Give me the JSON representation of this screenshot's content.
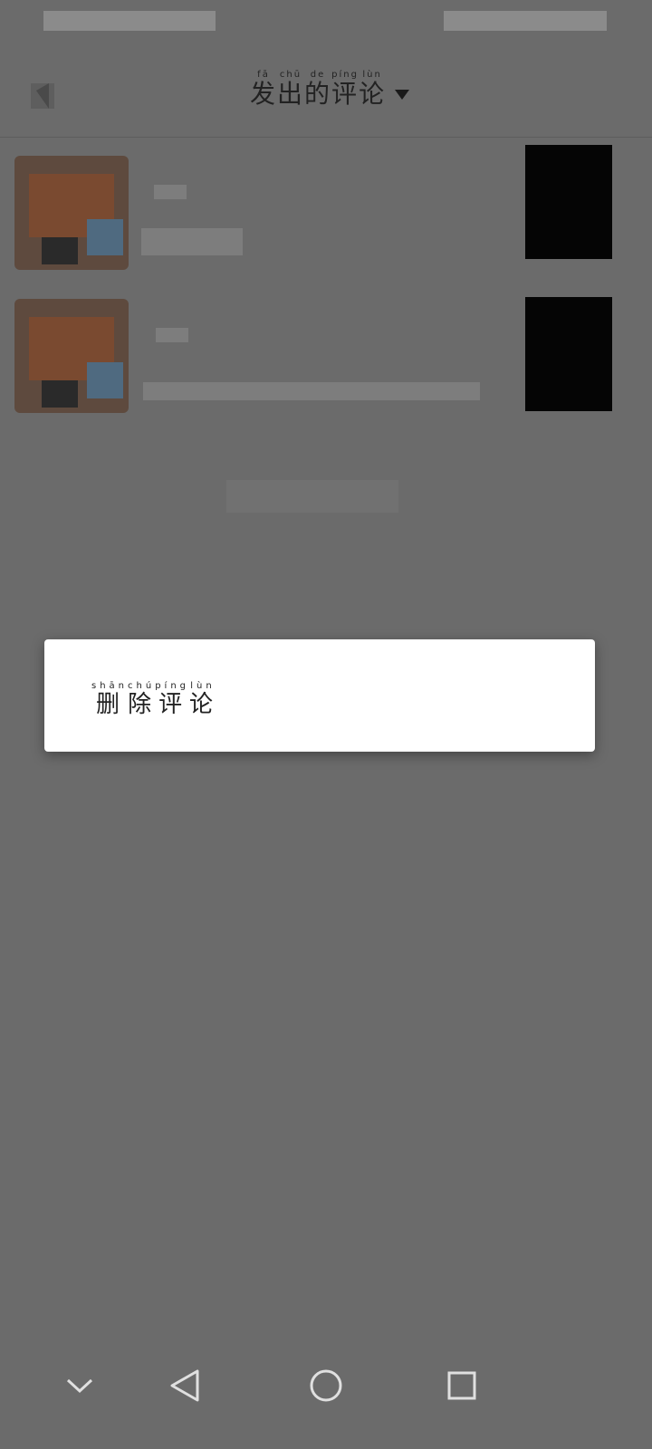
{
  "header": {
    "title": "发出的评论",
    "title_pinyin": [
      "fā",
      "chū",
      "de",
      "píng",
      "lùn"
    ],
    "title_chars": [
      "发",
      "出",
      "的",
      "评",
      "论"
    ]
  },
  "dialog": {
    "delete_label": "删除评论",
    "delete_pinyin": [
      "shān",
      "chú",
      "píng",
      "lùn"
    ],
    "delete_chars": [
      "删",
      "除",
      "评",
      "论"
    ]
  },
  "nav": {
    "icons": [
      "collapse-chevron-icon",
      "back-triangle-icon",
      "home-circle-icon",
      "recents-square-icon"
    ]
  },
  "colors": {
    "scrim": "#6b6b6b",
    "dialog_bg": "#ffffff",
    "text": "#222222"
  }
}
